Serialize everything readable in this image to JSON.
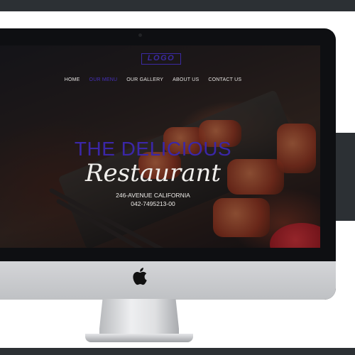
{
  "website": {
    "logo": "LOGO",
    "nav": [
      "HOME",
      "OUR MENU",
      "OUR GALLERY",
      "ABOUT US",
      "CONTACT US"
    ],
    "active_nav": "OUR MENU",
    "hero": {
      "title": "THE DELICIOUS",
      "script": "Restaurant",
      "address": "246-AVENUE CALIFORNIA",
      "phone": "042-7495213-00"
    }
  },
  "colors": {
    "accent": "#3b27a8",
    "frame_bezel": "#0e0f12",
    "chin": "#c8c9cc",
    "background_bars": "#2c3034"
  },
  "icons": [
    "apple-logo-icon",
    "camera-icon"
  ]
}
